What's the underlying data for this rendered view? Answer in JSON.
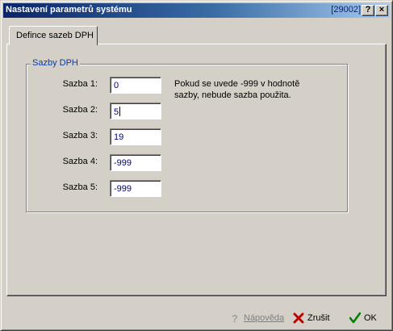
{
  "window": {
    "title": "Nastavení parametrů systému",
    "code": "[29002]",
    "help_button": "?",
    "close_button": "×"
  },
  "tab": {
    "label": "Defince sazeb DPH"
  },
  "group": {
    "title": "Sazby DPH"
  },
  "rows": [
    {
      "label": "Sazba 1:",
      "value": "0"
    },
    {
      "label": "Sazba 2:",
      "value": "5"
    },
    {
      "label": "Sazba 3:",
      "value": "19"
    },
    {
      "label": "Sazba 4:",
      "value": "-999"
    },
    {
      "label": "Sazba 5:",
      "value": "-999"
    }
  ],
  "note": "Pokud se uvede -999 v hodnotě sazby, nebude sazba použita.",
  "buttons": {
    "help": {
      "label": "Nápověda",
      "icon": "question-icon",
      "color": "#808080"
    },
    "cancel": {
      "label": "Zrušit",
      "icon": "red-x-icon",
      "color": "#c00000"
    },
    "ok": {
      "label": "OK",
      "icon": "green-check-icon",
      "color": "#008000"
    }
  },
  "colors": {
    "titlebar_start": "#0a246a",
    "titlebar_end": "#a6caf0",
    "face": "#d4d0c8",
    "group_title": "#0a3aa0"
  }
}
